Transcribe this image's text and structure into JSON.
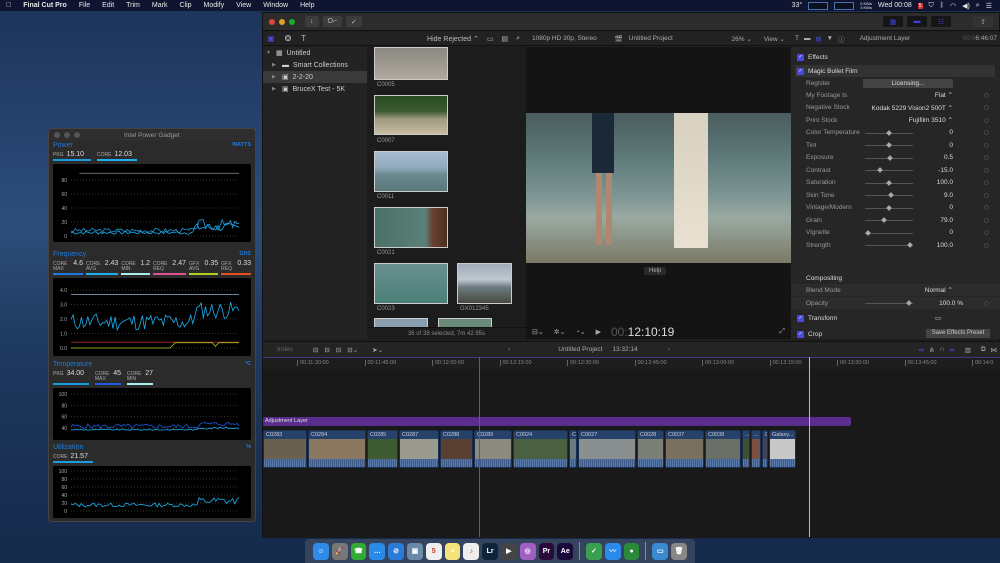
{
  "menubar": {
    "apple": "",
    "app_name": "Final Cut Pro",
    "menus": [
      "File",
      "Edit",
      "Trim",
      "Mark",
      "Clip",
      "Modify",
      "View",
      "Window",
      "Help"
    ],
    "temp": "33°",
    "net_up": "0 KB/s",
    "net_down": "3 KB/s",
    "clock": "Wed 00:08",
    "calendar_day": "5"
  },
  "power_gadget": {
    "title": "Intel Power Gadget",
    "power": {
      "title": "Power",
      "unit": "WATTS",
      "stats": [
        {
          "label": "PKG",
          "value": "15.10"
        },
        {
          "label": "CORE",
          "value": "12.03"
        }
      ],
      "yticks": [
        "80",
        "60",
        "40",
        "20",
        "0"
      ]
    },
    "frequency": {
      "title": "Frequency",
      "unit": "GHZ",
      "stats": [
        {
          "label": "CORE MAX",
          "value": "4.6"
        },
        {
          "label": "CORE AVG",
          "value": "2.43"
        },
        {
          "label": "CORE MIN",
          "value": "1.2"
        },
        {
          "label": "CORE REQ",
          "value": "2.47"
        },
        {
          "label": "GFX AVG",
          "value": "0.35"
        },
        {
          "label": "GFX REQ",
          "value": "0.33"
        }
      ],
      "yticks": [
        "4.0",
        "3.0",
        "2.0",
        "1.0",
        "0.0"
      ]
    },
    "temperature": {
      "title": "Temperature",
      "unit": "°C",
      "stats": [
        {
          "label": "PKG",
          "value": "34.00"
        },
        {
          "label": "CORE MAX",
          "value": "45"
        },
        {
          "label": "CORE MIN",
          "value": "27"
        }
      ],
      "yticks": [
        "100",
        "80",
        "60",
        "40"
      ]
    },
    "utilization": {
      "title": "Utilization",
      "unit": "%",
      "stats": [
        {
          "label": "CORE",
          "value": "21.57"
        }
      ],
      "yticks": [
        "100",
        "80",
        "60",
        "40",
        "20",
        "0"
      ]
    }
  },
  "fcp": {
    "toolbar": {
      "import": "↓",
      "keywords": "O⌐",
      "check": "✓"
    },
    "library": {
      "filter": "Hide Rejected ⌃",
      "items": [
        {
          "label": "Untitled",
          "level": 0,
          "expanded": true
        },
        {
          "label": "Smart Collections",
          "level": 1
        },
        {
          "label": "2-2-20",
          "level": 1,
          "selected": true
        },
        {
          "label": "BruceX Test  - 5K",
          "level": 1
        }
      ]
    },
    "browser": {
      "clips": [
        "C0005",
        "C0007",
        "C0011",
        "C0021",
        "C0023",
        "GX012345"
      ],
      "status": "36 of 38 selected, 7m 42.95s"
    },
    "viewer": {
      "format": "1080p HD 30p, Stereo",
      "project": "Untitled Project",
      "zoom": "26% ⌄",
      "view": "View ⌄",
      "help": "Help",
      "timecode_dim": "00:",
      "timecode": "12:10:19"
    },
    "inspector": {
      "title": "Adjustment Layer",
      "duration_dim": "00:0",
      "duration": "6:46:07",
      "effects_label": "Effects",
      "effect_name": "Magic Bullet Film",
      "register_label": "Register",
      "licensing_button": "Licensing...",
      "params": [
        {
          "label": "My Footage Is",
          "value": "Flat ⌃",
          "type": "popup"
        },
        {
          "label": "Negative Stock",
          "value": "Kodak 5229 Vision2 500T ⌃",
          "type": "popup"
        },
        {
          "label": "Print Stock",
          "value": "Fujifilm 3510 ⌃",
          "type": "popup"
        },
        {
          "label": "Color Temperature",
          "value": "0",
          "type": "slider",
          "pos": 0.5
        },
        {
          "label": "Tint",
          "value": "0",
          "type": "slider",
          "pos": 0.5
        },
        {
          "label": "Exposure",
          "value": "0.5",
          "type": "slider",
          "pos": 0.52
        },
        {
          "label": "Contrast",
          "value": "-15.0",
          "type": "slider",
          "pos": 0.3
        },
        {
          "label": "Saturation",
          "value": "100.0",
          "type": "slider",
          "pos": 0.5
        },
        {
          "label": "Skin Tone",
          "value": "9.0",
          "type": "slider",
          "pos": 0.55
        },
        {
          "label": "Vintage/Modern",
          "value": "0",
          "type": "slider",
          "pos": 0.5
        },
        {
          "label": "Grain",
          "value": "79.0",
          "type": "slider",
          "pos": 0.38
        },
        {
          "label": "Vignette",
          "value": "0",
          "type": "slider",
          "pos": 0.03
        },
        {
          "label": "Strength",
          "value": "100.0",
          "type": "slider",
          "pos": 0.97
        }
      ],
      "compositing_label": "Compositing",
      "blend_mode_label": "Blend Mode",
      "blend_mode_value": "Normal ⌃",
      "opacity_label": "Opacity",
      "opacity_value": "100.0 %",
      "opacity_pos": 0.95,
      "transform_label": "Transform",
      "crop_label": "Crop",
      "save_preset": "Save Effects Preset"
    },
    "timeline": {
      "index": "Index",
      "project": "Untitled Project",
      "duration": "13:32:14",
      "ruler": [
        "00:11:30:00",
        "00:11:45:00",
        "00:12:00:00",
        "00:12:15:00",
        "00:12:30:00",
        "00:12:45:00",
        "00:13:00:00",
        "00:13:15:00",
        "00:13:30:00",
        "00:13:45:00",
        "00:14:0"
      ],
      "adjustment_layer": "Adjustment Layer",
      "clips": [
        {
          "name": "C0283",
          "w": 44,
          "color": "#6a6050"
        },
        {
          "name": "C0284",
          "w": 58,
          "color": "#8a7860"
        },
        {
          "name": "C0285",
          "w": 31,
          "color": "#3e5a30"
        },
        {
          "name": "C0287",
          "w": 40,
          "color": "#9a9a90"
        },
        {
          "name": "C0288",
          "w": 33,
          "color": "#5a4030"
        },
        {
          "name": "C0289",
          "w": 38,
          "color": "#8a8a80"
        },
        {
          "name": "C0024",
          "w": 55,
          "color": "#4a6040"
        },
        {
          "name": "C",
          "w": 8,
          "color": "#6a7a80"
        },
        {
          "name": "C0027",
          "w": 58,
          "color": "#8a9090"
        },
        {
          "name": "C0028",
          "w": 27,
          "color": "#7a8078"
        },
        {
          "name": "C0037",
          "w": 39,
          "color": "#7a7060"
        },
        {
          "name": "C0038",
          "w": 36,
          "color": "#6a7068"
        },
        {
          "name": "...",
          "w": 8,
          "color": "#3a5030"
        },
        {
          "name": "...",
          "w": 10,
          "color": "#7a5040"
        },
        {
          "name": "C",
          "w": 6,
          "color": "#445"
        },
        {
          "name": "Galaxy...",
          "w": 27,
          "color": "#c8c8c8"
        }
      ]
    }
  },
  "dock": {
    "apps": [
      {
        "name": "finder",
        "label": "☺",
        "color": "#2f8be8"
      },
      {
        "name": "launchpad",
        "label": "🚀",
        "color": "#777"
      },
      {
        "name": "facetime",
        "label": "☎",
        "color": "#3a3"
      },
      {
        "name": "messages",
        "label": "…",
        "color": "#2a8ae8"
      },
      {
        "name": "safari",
        "label": "⊘",
        "color": "#2a7ad8"
      },
      {
        "name": "preview",
        "label": "▣",
        "color": "#6a8aaa"
      },
      {
        "name": "calendar",
        "label": "5",
        "color": "#eee"
      },
      {
        "name": "notes",
        "label": "≡",
        "color": "#f5e27a"
      },
      {
        "name": "music",
        "label": "♪",
        "color": "#eee"
      },
      {
        "name": "lightroom",
        "label": "Lr",
        "color": "#0d2538"
      },
      {
        "name": "final-cut-pro",
        "label": "▶",
        "color": "#444"
      },
      {
        "name": "motion",
        "label": "◎",
        "color": "#a060c0"
      },
      {
        "name": "premiere",
        "label": "Pr",
        "color": "#2a0a3a"
      },
      {
        "name": "after-effects",
        "label": "Ae",
        "color": "#1a0a3a"
      },
      {
        "name": "adguard",
        "label": "✓",
        "color": "#3aa050"
      },
      {
        "name": "power-gadget",
        "label": "〰",
        "color": "#2a8ae8"
      },
      {
        "name": "globe",
        "label": "●",
        "color": "#2a8a3a"
      },
      {
        "name": "downloads",
        "label": "▭",
        "color": "#3a8ad0"
      },
      {
        "name": "trash",
        "label": "🗑",
        "color": "#888"
      }
    ]
  }
}
